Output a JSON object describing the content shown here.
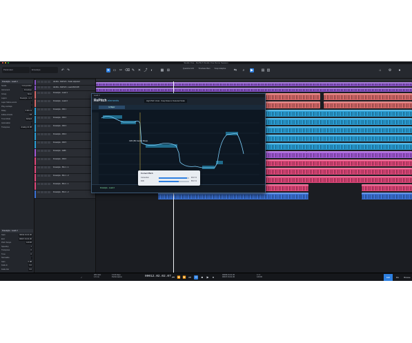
{
  "window": {
    "title": "Studio One - RePitch Studio One Demo Session"
  },
  "toolbar": {
    "left_field_1": "Parameter",
    "left_field_2": "Envelope",
    "timebase": "Quantize 1/16",
    "snap": "Timebase Bars",
    "nudge": "Snap Adaptive"
  },
  "inspector": {
    "track_name": "Freestyle - Lead 2",
    "rows": [
      {
        "label": "Sends",
        "value": "Composition"
      },
      {
        "label": "Instrument",
        "value": "Envelope"
      },
      {
        "label": "Group",
        "value": "None"
      },
      {
        "label": "Layers",
        "value": "Freestyle - Lt 1"
      },
      {
        "label": "Layer follow events",
        "value": ""
      },
      {
        "label": "Play overlaps",
        "value": ""
      },
      {
        "label": "Delay",
        "value": "0.00 ms"
      },
      {
        "label": "Follow chords",
        "value": "Off"
      },
      {
        "label": "Tune Mode",
        "value": "Default"
      },
      {
        "label": "Automation",
        "value": ""
      },
      {
        "label": "Transpose",
        "value": "Analog 12 dB"
      }
    ],
    "event_name": "Freestyle - Lead 2",
    "event_rows": [
      {
        "label": "Start",
        "value": "00011.01.01.00"
      },
      {
        "label": "End",
        "value": "00017.01.01.00"
      },
      {
        "label": "Pitch Tempo",
        "value": "120.00"
      },
      {
        "label": "Speedup",
        "value": "1"
      },
      {
        "label": "Transpose",
        "value": "0"
      },
      {
        "label": "Tune",
        "value": "0"
      },
      {
        "label": "Normalize",
        "value": ""
      },
      {
        "label": "Gain",
        "value": "0 dB"
      },
      {
        "label": "Fade-In",
        "value": "0.0"
      },
      {
        "label": "Fade-Out",
        "value": "0.0"
      }
    ]
  },
  "tracks": [
    {
      "name": "Ad-libs - RePitch - Scale adjusted",
      "color": "#8a54c9"
    },
    {
      "name": "Ad-libs - RePitch - Lead 2024-08",
      "color": "#8a54c9"
    },
    {
      "name": "Freestyle - Lead 1",
      "color": "#d86a6a"
    },
    {
      "name": "Freestyle - Lead 2",
      "color": "#d86a6a"
    },
    {
      "name": "Freestyle - Dbl 1",
      "color": "#2aa0d8"
    },
    {
      "name": "Freestyle - Dbl 2",
      "color": "#2aa0d8"
    },
    {
      "name": "Freestyle - Dbl 3",
      "color": "#2aa0d8"
    },
    {
      "name": "Freestyle - Dbl 4",
      "color": "#2aa0d8"
    },
    {
      "name": "Freestyle - Dbl 5",
      "color": "#2aa0d8"
    },
    {
      "name": "Freestyle - Adlib",
      "color": "#a35ad8"
    },
    {
      "name": "Freestyle - Dbl 6",
      "color": "#e0477a"
    },
    {
      "name": "Freestyle - BG 1 - 1",
      "color": "#e0477a"
    },
    {
      "name": "Freestyle - BG 1 - 2",
      "color": "#e0477a"
    },
    {
      "name": "Freestyle - BG 2 - 1",
      "color": "#e0477a"
    },
    {
      "name": "Freestyle - BG 2 - 2",
      "color": "#3b73d8"
    }
  ],
  "repitch": {
    "title": "Lead 2",
    "logo": "RePitch",
    "logo_sub": "elements",
    "preset": "High Pitch Vocal - Snap Notes to Selected Scale",
    "scale": "E Major",
    "note_label": "C#3 (56 Cents) Sharp",
    "track_label": "Freestyle - Lead 2",
    "popup": {
      "title": "Correct Pitch",
      "rows": [
        {
          "label": "Correction",
          "value": "93.0 %",
          "pct": 93
        },
        {
          "label": "Drift",
          "value": "65.0 %",
          "pct": 65
        }
      ]
    }
  },
  "transport": {
    "sample_rate": "48.0 kHz",
    "latency": "1.6 ms",
    "record_max": "13:20 days",
    "perf": "Performance",
    "time": "00012.02.02.07",
    "loop_start": "00009.01.01.00",
    "loop_end": "00017.01.01.00",
    "meter": "4 / 4",
    "tempo": "120.00",
    "tab_edit": "Edit",
    "tab_mix": "Mix",
    "tab_browse": "Browse"
  }
}
